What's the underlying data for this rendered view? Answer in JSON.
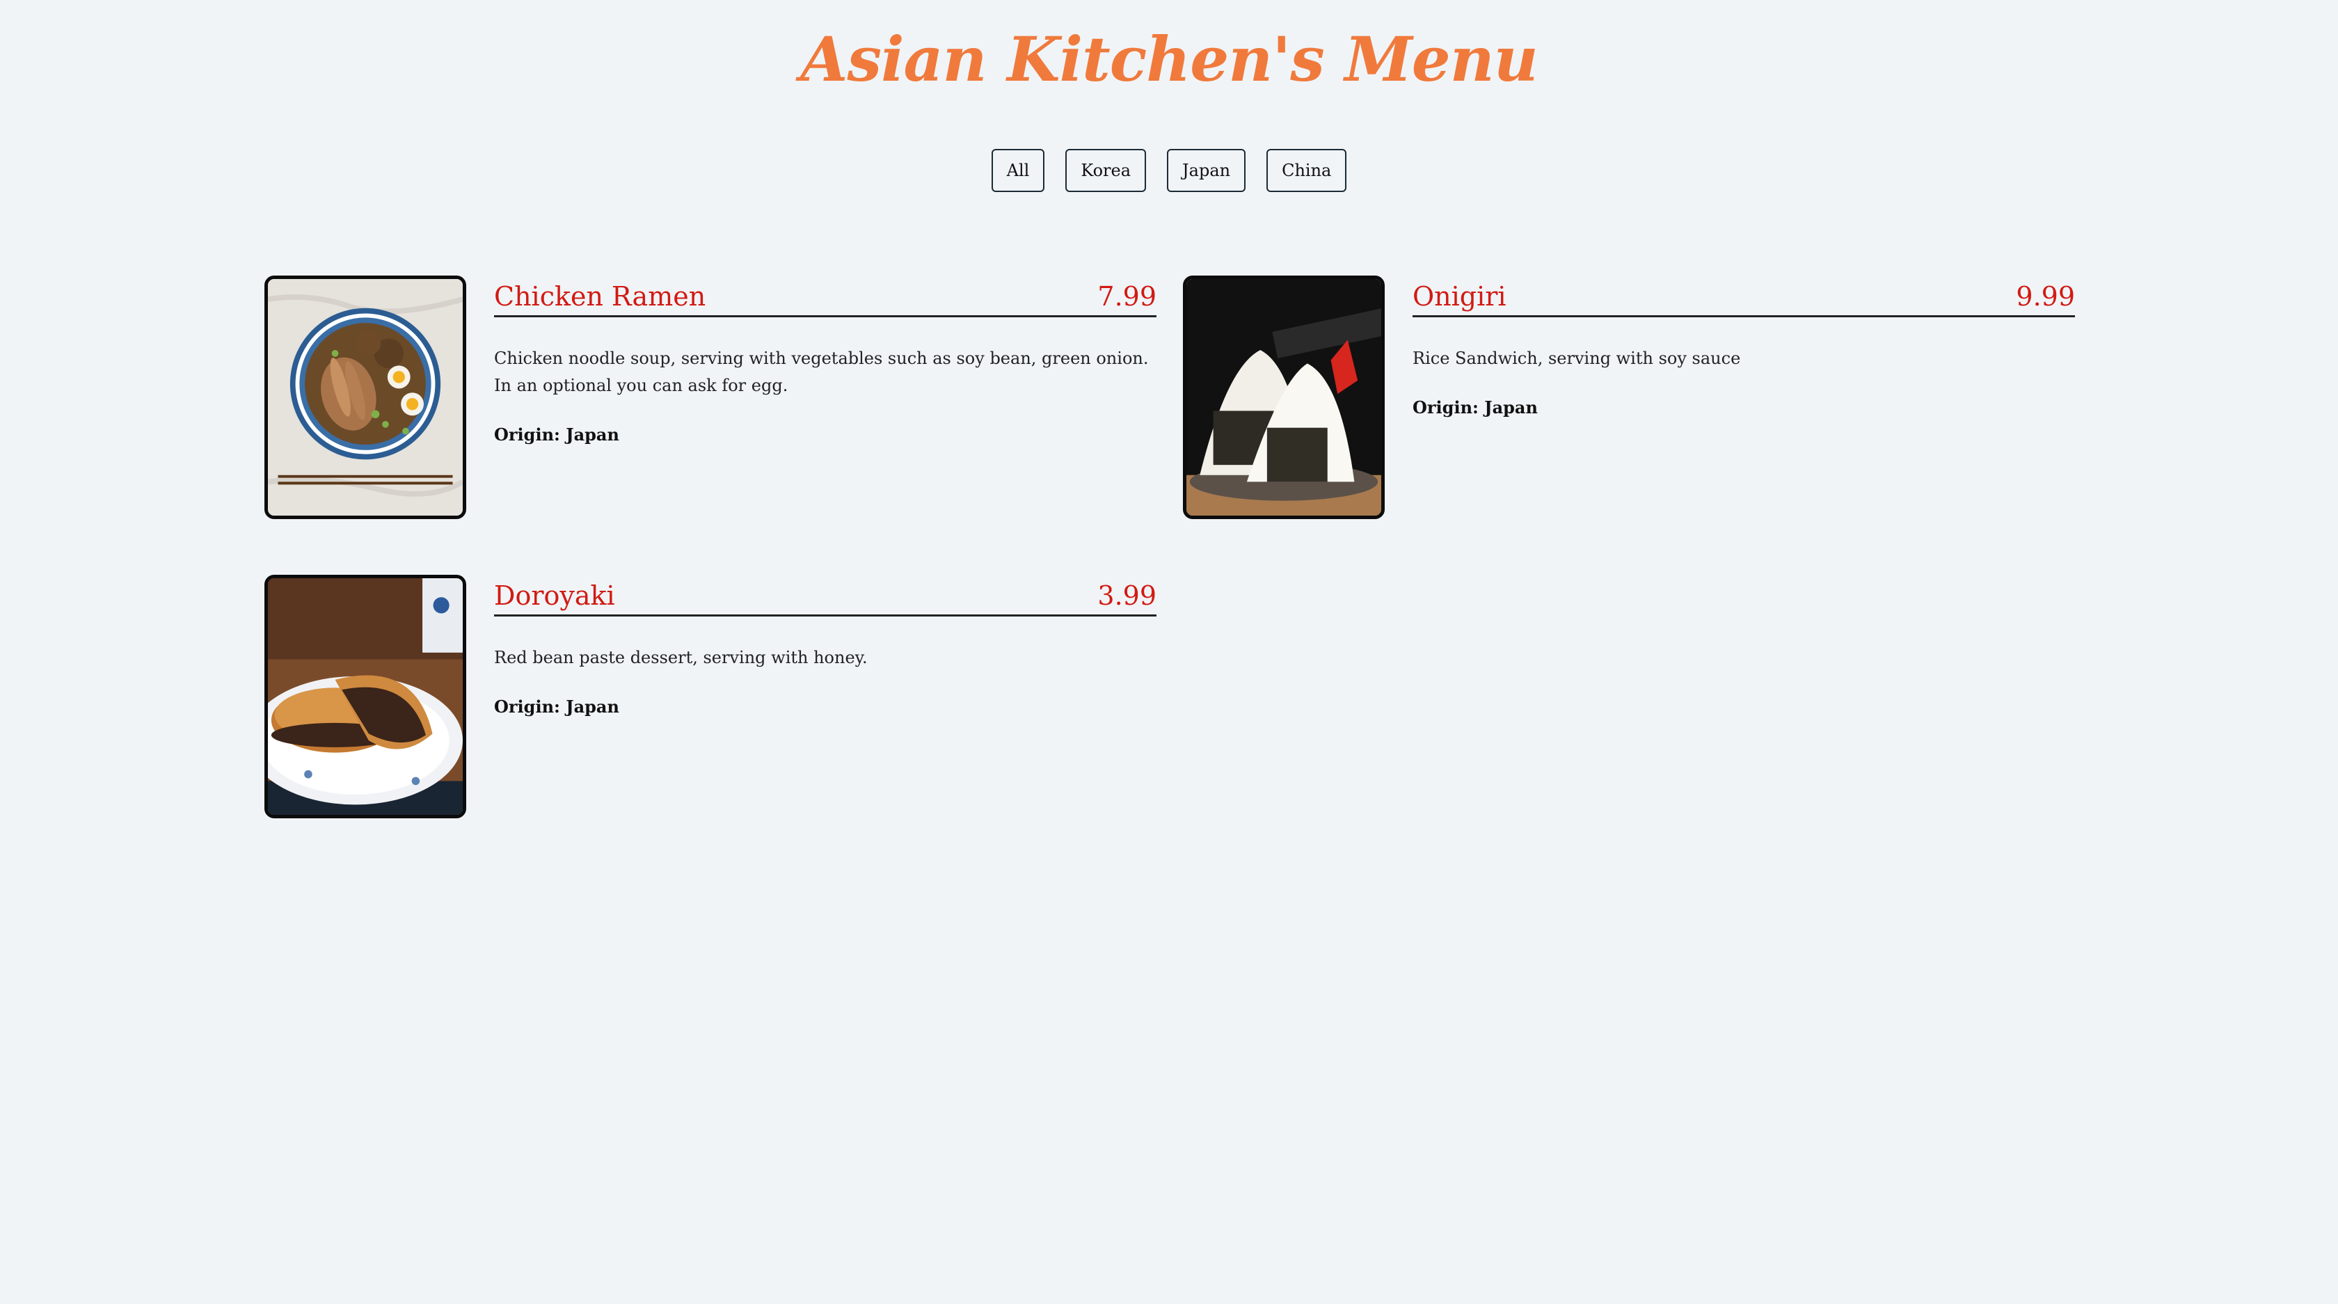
{
  "page": {
    "title": "Asian Kitchen's Menu"
  },
  "filters": [
    {
      "label": "All"
    },
    {
      "label": "Korea"
    },
    {
      "label": "Japan"
    },
    {
      "label": "China"
    }
  ],
  "menu_items": [
    {
      "name": "Chicken Ramen",
      "price": "7.99",
      "description": "Chicken noodle soup, serving with vegetables such as soy bean, green onion. In an optional you can ask for egg.",
      "origin": "Origin: Japan",
      "photo": "chicken-ramen-photo"
    },
    {
      "name": "Onigiri",
      "price": "9.99",
      "description": "Rice Sandwich, serving with soy sauce",
      "origin": "Origin: Japan",
      "photo": "onigiri-photo"
    },
    {
      "name": "Doroyaki",
      "price": "3.99",
      "description": "Red bean paste dessert, serving with honey.",
      "origin": "Origin: Japan",
      "photo": "doroyaki-photo"
    }
  ],
  "colors": {
    "background": "#f0f4f7",
    "title": "#f07a3c",
    "item_name": "#d21a12",
    "text": "#222222"
  }
}
